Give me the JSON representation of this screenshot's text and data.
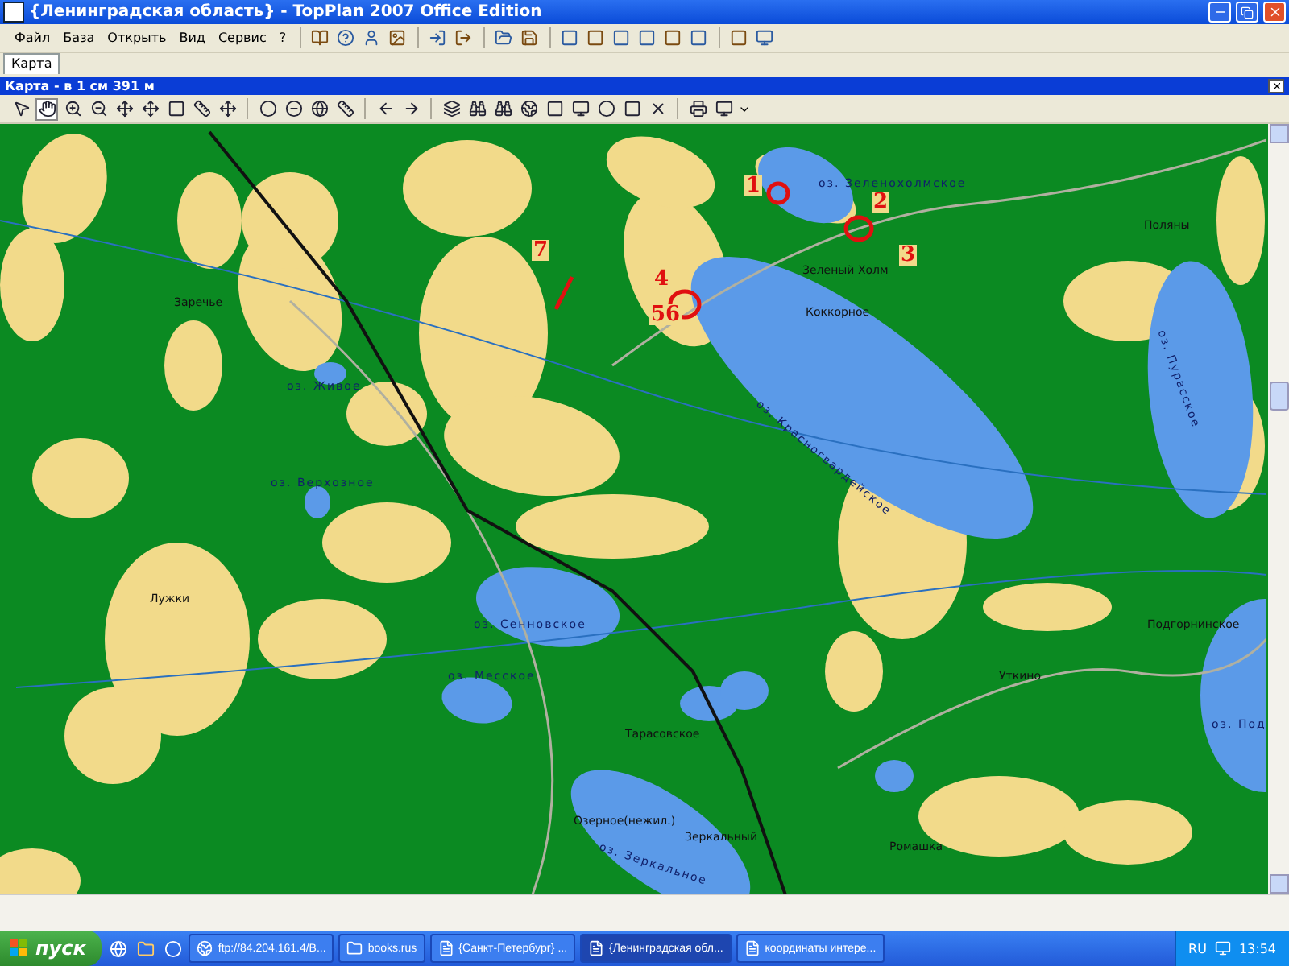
{
  "window": {
    "title": "{Ленинградская область} - TopPlan 2007 Office Edition"
  },
  "menu": [
    "Файл",
    "База",
    "Открыть",
    "Вид",
    "Сервис",
    "?"
  ],
  "tabs": [
    {
      "label": "Карта",
      "selected": true
    }
  ],
  "map_window": {
    "title": "Карта - в 1 см 391 м"
  },
  "map": {
    "labels": [
      {
        "text": "оз. Зеленохолмское",
        "kind": "lake"
      },
      {
        "text": "Зеленый Холм",
        "kind": "place"
      },
      {
        "text": "Коккорное",
        "kind": "place"
      },
      {
        "text": "Поляны",
        "kind": "place"
      },
      {
        "text": "оз. Пурасское",
        "kind": "lake"
      },
      {
        "text": "оз. Красногвардейское",
        "kind": "lake"
      },
      {
        "text": "Заречье",
        "kind": "place"
      },
      {
        "text": "оз. Живое",
        "kind": "lake"
      },
      {
        "text": "оз. Верхозное",
        "kind": "lake"
      },
      {
        "text": "Лужки",
        "kind": "place"
      },
      {
        "text": "оз. Сенновское",
        "kind": "lake"
      },
      {
        "text": "оз. Месское",
        "kind": "lake"
      },
      {
        "text": "Тарасовское",
        "kind": "place"
      },
      {
        "text": "Уткино",
        "kind": "place"
      },
      {
        "text": "Подгорнинское",
        "kind": "place"
      },
      {
        "text": "оз. Под",
        "kind": "lake"
      },
      {
        "text": "Озерное(нежил.)",
        "kind": "place"
      },
      {
        "text": "Зеркальный",
        "kind": "place"
      },
      {
        "text": "Ромашка",
        "kind": "place"
      },
      {
        "text": "оз. Зеркальное",
        "kind": "lake"
      },
      {
        "text": "1",
        "kind": "note"
      },
      {
        "text": "2",
        "kind": "note"
      },
      {
        "text": "3",
        "kind": "note"
      },
      {
        "text": "4",
        "kind": "note"
      },
      {
        "text": "56",
        "kind": "note"
      },
      {
        "text": "7",
        "kind": "note"
      }
    ]
  },
  "taskbar": {
    "start": "пуск",
    "tasks": [
      {
        "label": "ftp://84.204.161.4/B...",
        "selected": false
      },
      {
        "label": "books.rus",
        "selected": false
      },
      {
        "label": "{Санкт-Петербург} ...",
        "selected": false
      },
      {
        "label": "{Ленинградская обл...",
        "selected": true
      },
      {
        "label": "координаты интере...",
        "selected": false
      }
    ],
    "language": "RU",
    "clock": "13:54"
  }
}
